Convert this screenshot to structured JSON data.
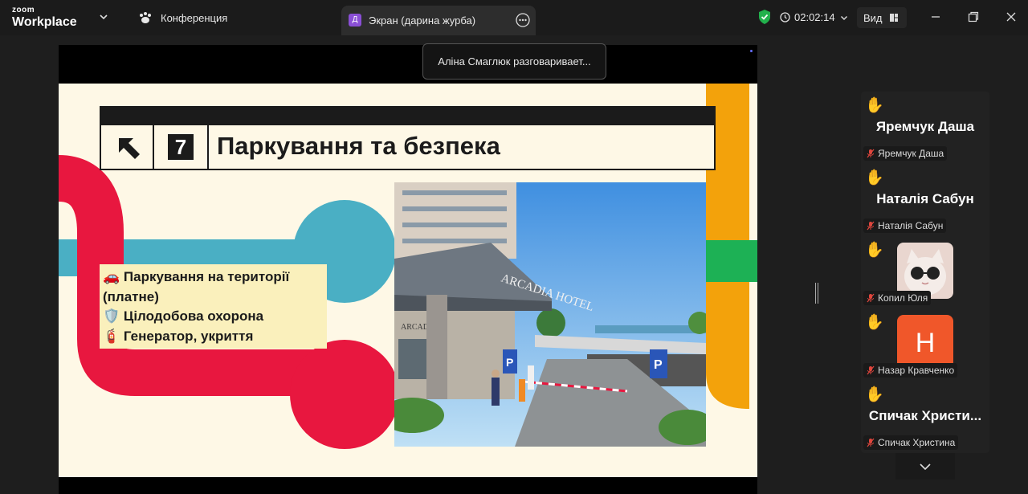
{
  "app": {
    "brand_top": "zoom",
    "brand_main": "Workplace"
  },
  "topbar": {
    "conference_label": "Конференция",
    "screen_tab": {
      "badge": "Д",
      "label": "Экран (дарина журба)"
    },
    "timer": "02:02:14",
    "view_label": "Вид"
  },
  "notification": {
    "text": "Аліна Смаглюк разговаривает..."
  },
  "slide": {
    "number": "7",
    "title": "Паркування та безпека",
    "items": [
      {
        "icon": "🚗",
        "text": "Паркування на території"
      },
      {
        "icon": "",
        "text": "(платне)"
      },
      {
        "icon": "🛡️",
        "text": "Цілодобова охорона"
      },
      {
        "icon": "🧯",
        "text": "Генератор, укриття"
      }
    ],
    "photo": {
      "hotel_sign": "ARCADIA HOTEL",
      "side_sign": "ARCADIA"
    }
  },
  "participants": [
    {
      "hand": "✋",
      "display": "Яремчук Даша",
      "name": "Яремчук Даша",
      "avatar": "none"
    },
    {
      "hand": "✋",
      "display": "Наталія Сабун",
      "name": "Наталія Сабун",
      "avatar": "none"
    },
    {
      "hand": "✋",
      "display": "",
      "name": "Копил Юля",
      "avatar": "photo"
    },
    {
      "hand": "✋",
      "display": "",
      "name": "Назар Кравченко",
      "avatar": "letter",
      "letter": "H"
    },
    {
      "hand": "✋",
      "display": "Спичак  Христи...",
      "name": "Спичак Христина",
      "avatar": "none"
    }
  ],
  "colors": {
    "slide_bg": "#fef8e6",
    "red": "#e8173f",
    "teal": "#4aafc4",
    "orange": "#f3a20b",
    "green": "#1db155",
    "mic_muted": "#e0463d",
    "avatar_orange": "#f0572a",
    "shield_green": "#22b14c"
  }
}
